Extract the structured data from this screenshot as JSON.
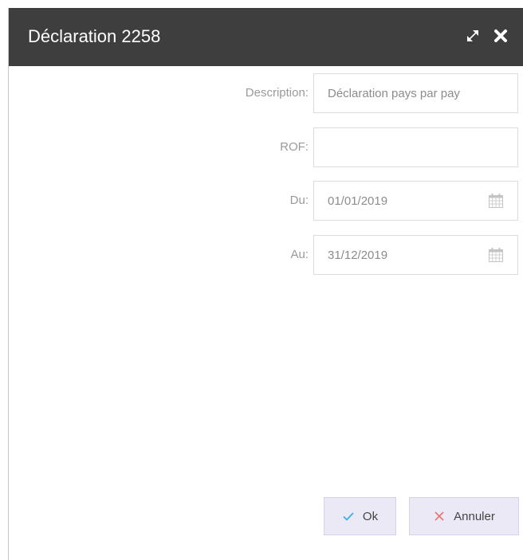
{
  "dialog": {
    "title": "Déclaration 2258",
    "icons": {
      "expand": "expand-icon",
      "close": "close-icon"
    }
  },
  "form": {
    "description": {
      "label": "Description:",
      "value": "Déclaration pays par pay"
    },
    "rof": {
      "label": "ROF:",
      "value": ""
    },
    "du": {
      "label": "Du:",
      "value": "01/01/2019",
      "icon": "calendar-icon"
    },
    "au": {
      "label": "Au:",
      "value": "31/12/2019",
      "icon": "calendar-icon"
    }
  },
  "buttons": {
    "ok": {
      "label": "Ok",
      "icon": "check-icon",
      "icon_color": "#3ab0e8"
    },
    "cancel": {
      "label": "Annuler",
      "icon": "x-icon",
      "icon_color": "#e57373"
    }
  },
  "colors": {
    "titlebar": "#3e3e3e",
    "button_bg": "#ece9f7"
  }
}
